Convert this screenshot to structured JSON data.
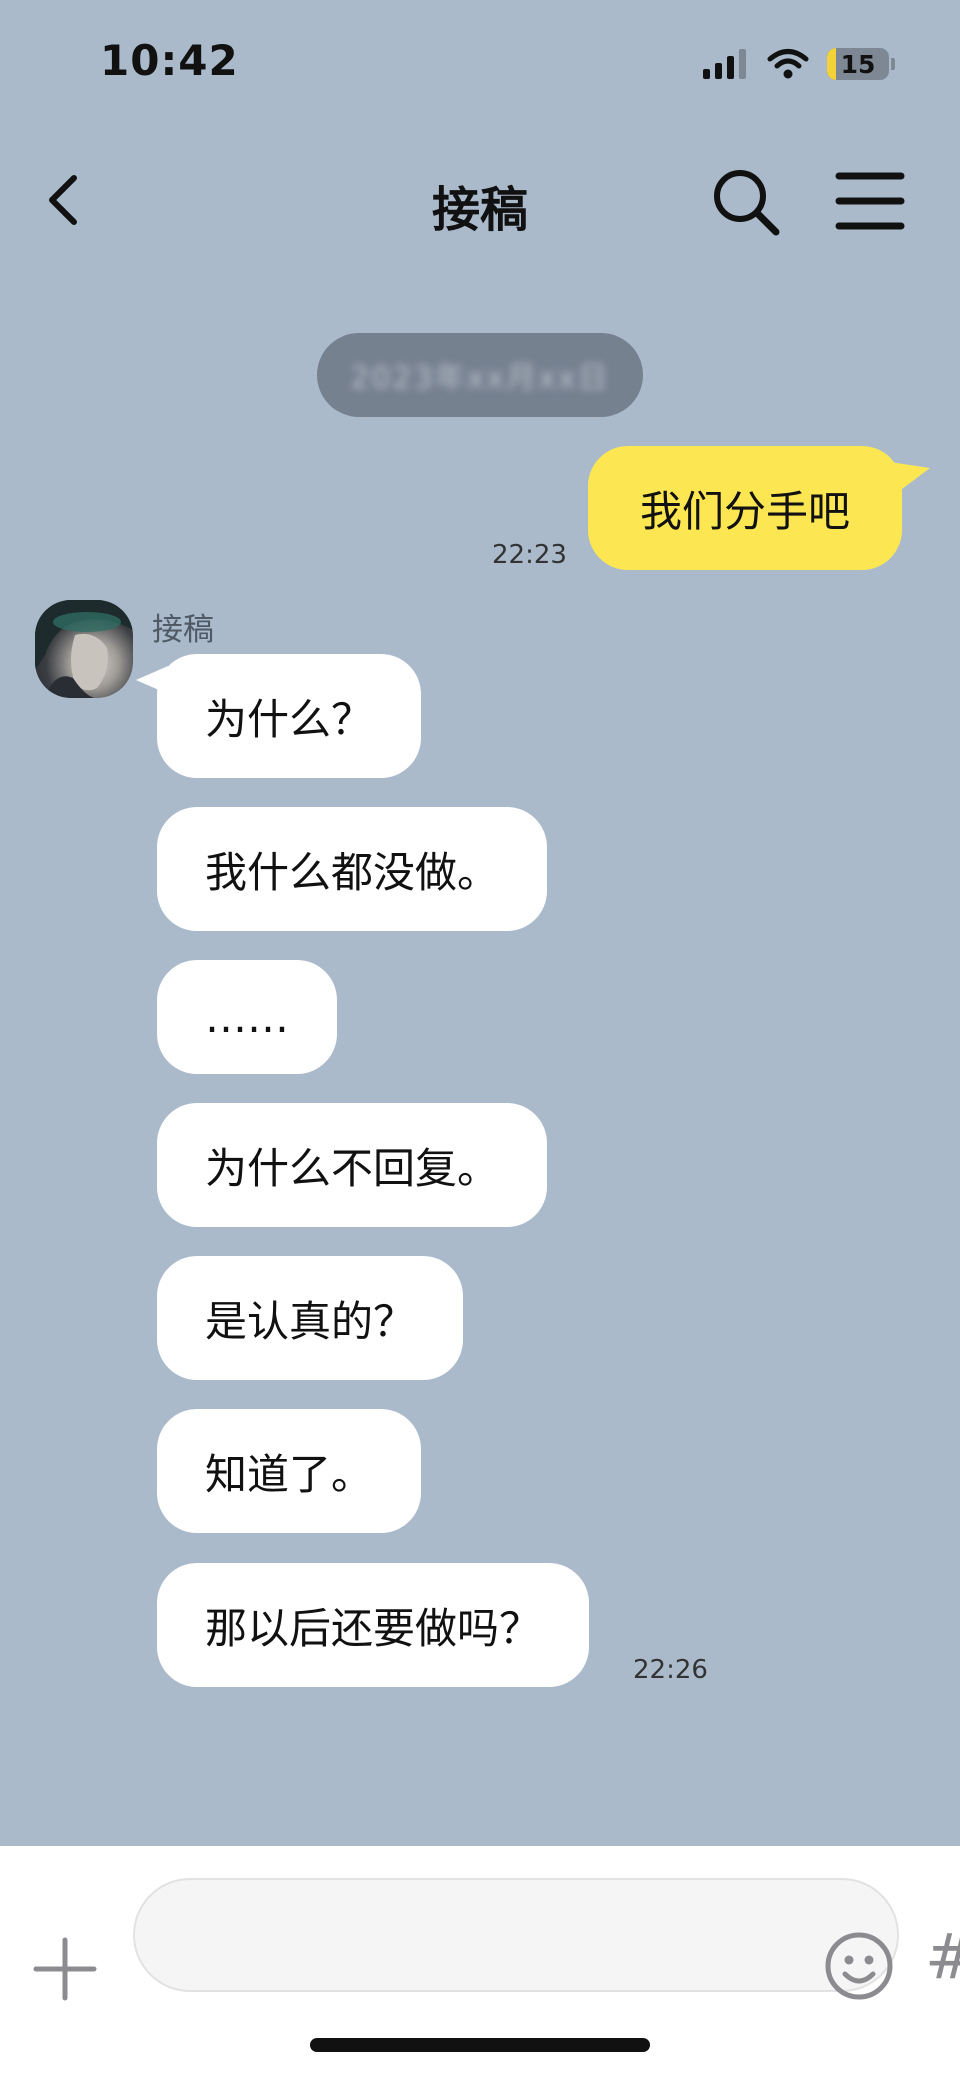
{
  "status_bar": {
    "time": "10:42",
    "battery_level": "15",
    "icons": [
      "signal-icon",
      "wifi-icon",
      "battery-icon"
    ]
  },
  "header": {
    "back_icon": "chevron-left-icon",
    "title": "接稿",
    "search_icon": "search-icon",
    "menu_icon": "menu-icon"
  },
  "date_divider": "2023年xx月xx日",
  "messages": {
    "outgoing": [
      {
        "text": "我们分手吧",
        "time": "22:23"
      }
    ],
    "sender_name": "接稿",
    "incoming": [
      {
        "text": "为什么？"
      },
      {
        "text": "我什么都没做。"
      },
      {
        "text": "……"
      },
      {
        "text": "为什么不回复。"
      },
      {
        "text": "是认真的？"
      },
      {
        "text": "知道了。"
      },
      {
        "text": "那以后还要做吗？",
        "time": "22:26"
      }
    ]
  },
  "composer": {
    "plus_icon": "plus-icon",
    "emoji_icon": "smiley-icon",
    "hashtag_label": "#"
  },
  "colors": {
    "background": "#aabacb",
    "outgoing_bubble": "#fce752",
    "incoming_bubble": "#ffffff"
  }
}
